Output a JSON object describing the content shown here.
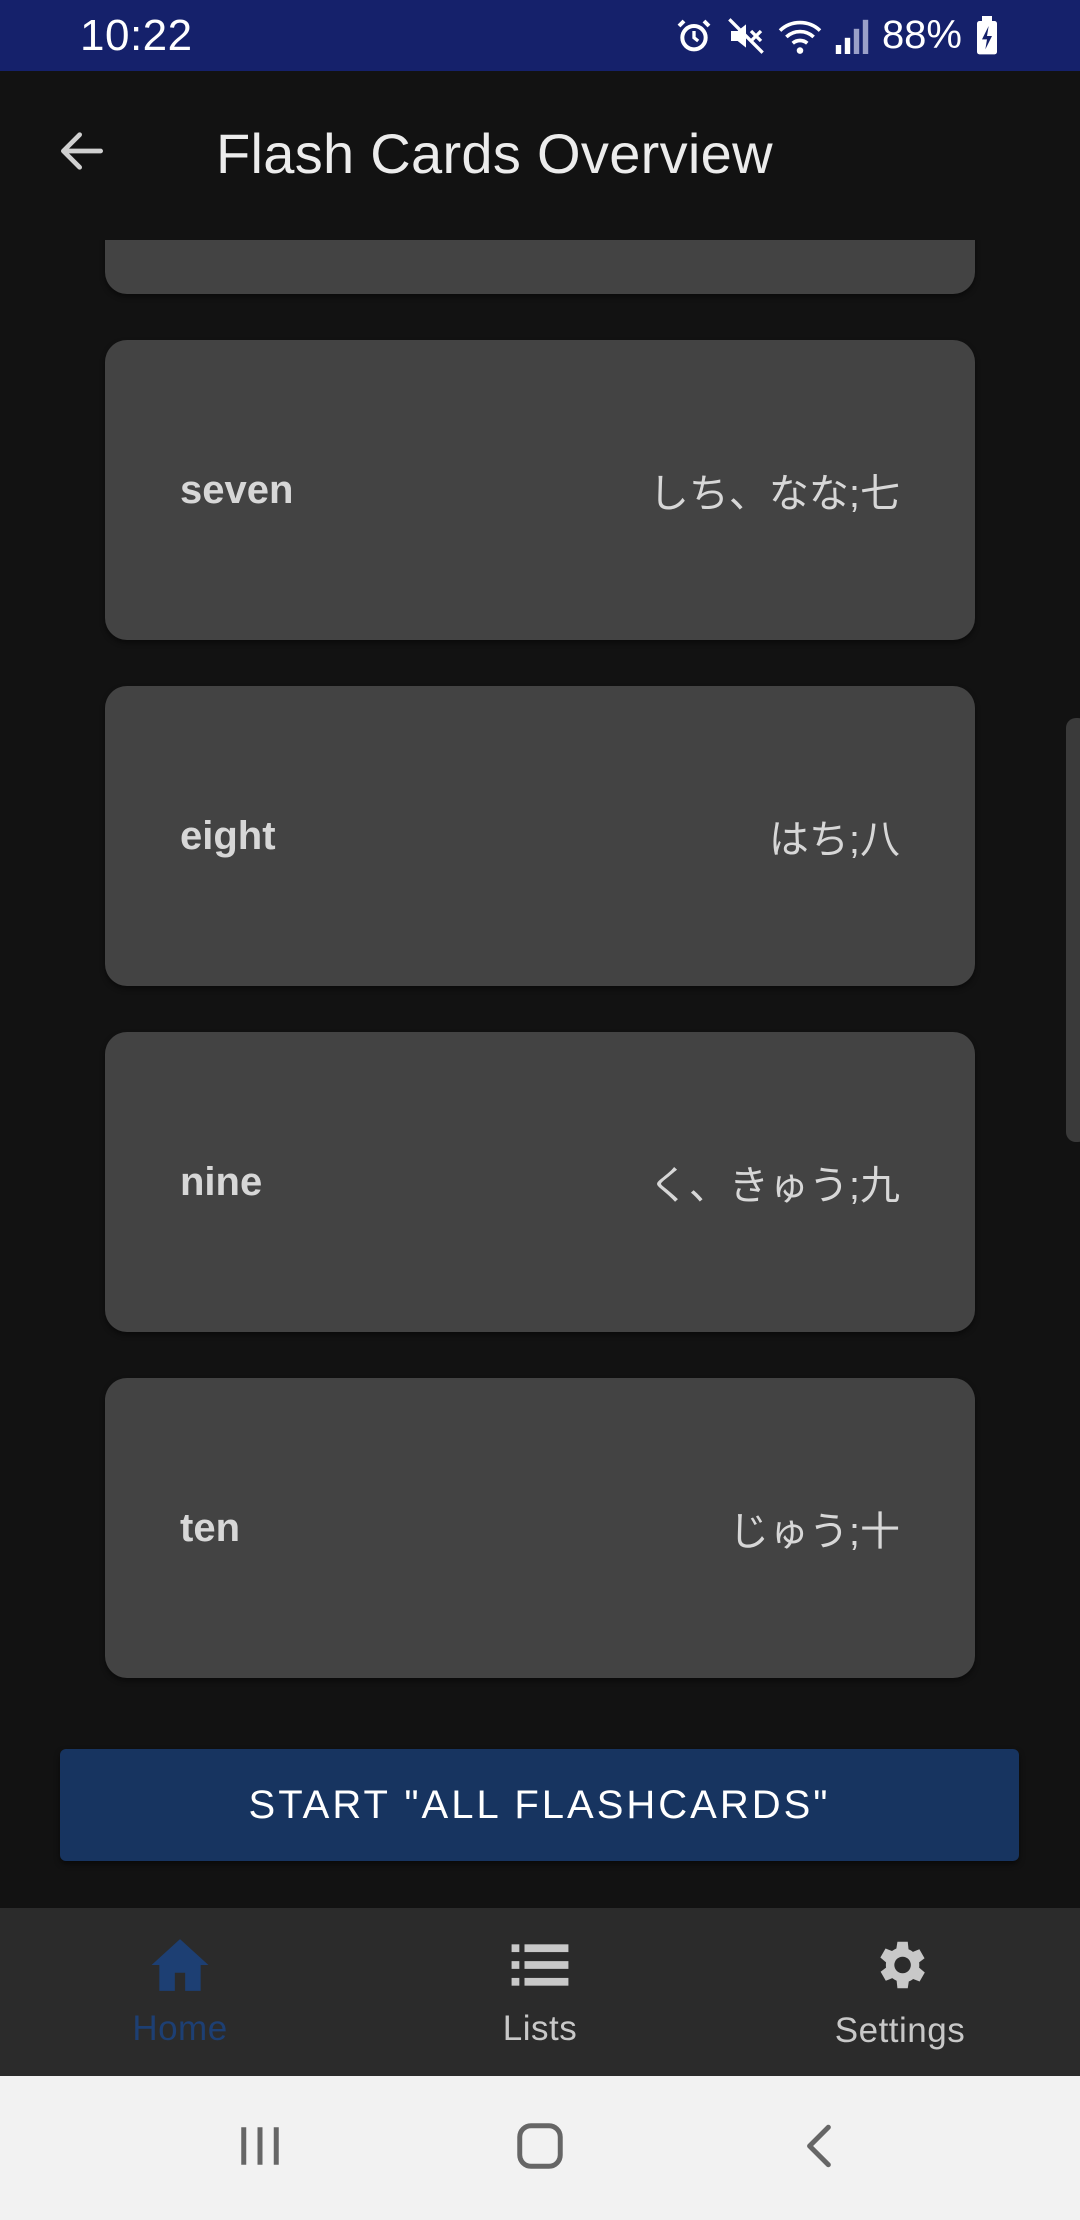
{
  "status_bar": {
    "time": "10:22",
    "battery": "88%",
    "icons": [
      "alarm-icon",
      "mute-icon",
      "wifi-icon",
      "signal-icon",
      "battery-charging-icon"
    ]
  },
  "app_bar": {
    "title": "Flash Cards Overview",
    "back_icon": "back-arrow-icon"
  },
  "cards": [
    {
      "term": "",
      "definition": ""
    },
    {
      "term": "seven",
      "definition": "しち、なな;七"
    },
    {
      "term": "eight",
      "definition": "はち;八"
    },
    {
      "term": "nine",
      "definition": "く、きゅう;九"
    },
    {
      "term": "ten",
      "definition": "じゅう;十"
    }
  ],
  "start_button": {
    "label": "START \"ALL FLASHCARDS\""
  },
  "bottom_nav": {
    "items": [
      {
        "label": "Home",
        "icon": "home-icon",
        "active": true
      },
      {
        "label": "Lists",
        "icon": "list-icon",
        "active": false
      },
      {
        "label": "Settings",
        "icon": "gear-icon",
        "active": false
      }
    ]
  },
  "colors": {
    "status_bar": "#15216b",
    "background": "#121212",
    "card": "#434343",
    "accent": "#1d3f73",
    "button": "#173460"
  }
}
